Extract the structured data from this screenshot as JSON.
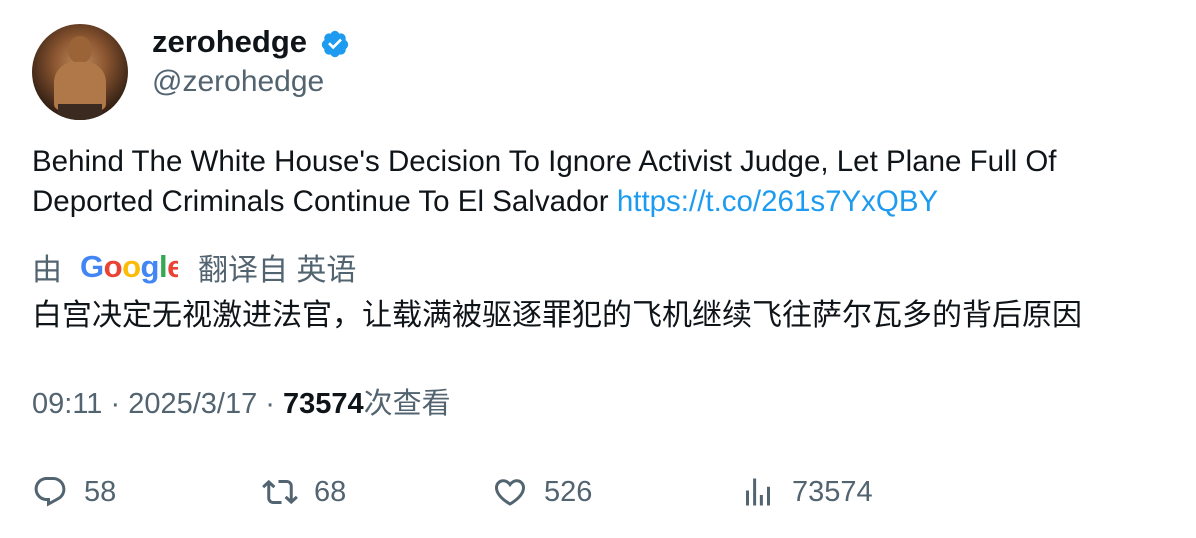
{
  "author": {
    "display_name": "zerohedge",
    "handle": "@zerohedge",
    "verified": true,
    "verified_color": "#1d9bf0"
  },
  "tweet": {
    "text": "Behind The White House's Decision To Ignore Activist Judge, Let Plane Full Of Deported Criminals Continue To El Salvador ",
    "link": "https://t.co/261s7YxQBY",
    "link_color": "#1d9bf0"
  },
  "translation": {
    "prefix": "由",
    "provider_logo": "Google",
    "suffix": "翻译自 英语",
    "text": "白宫决定无视激进法官，让载满被驱逐罪犯的飞机继续飞往萨尔瓦多的背后原因"
  },
  "meta": {
    "time": "09:11",
    "sep1": " · ",
    "date": "2025/3/17",
    "sep2": " · ",
    "views": "73574",
    "views_label": "次查看"
  },
  "actions": {
    "replies": "58",
    "retweets": "68",
    "likes": "526",
    "views": "73574"
  }
}
